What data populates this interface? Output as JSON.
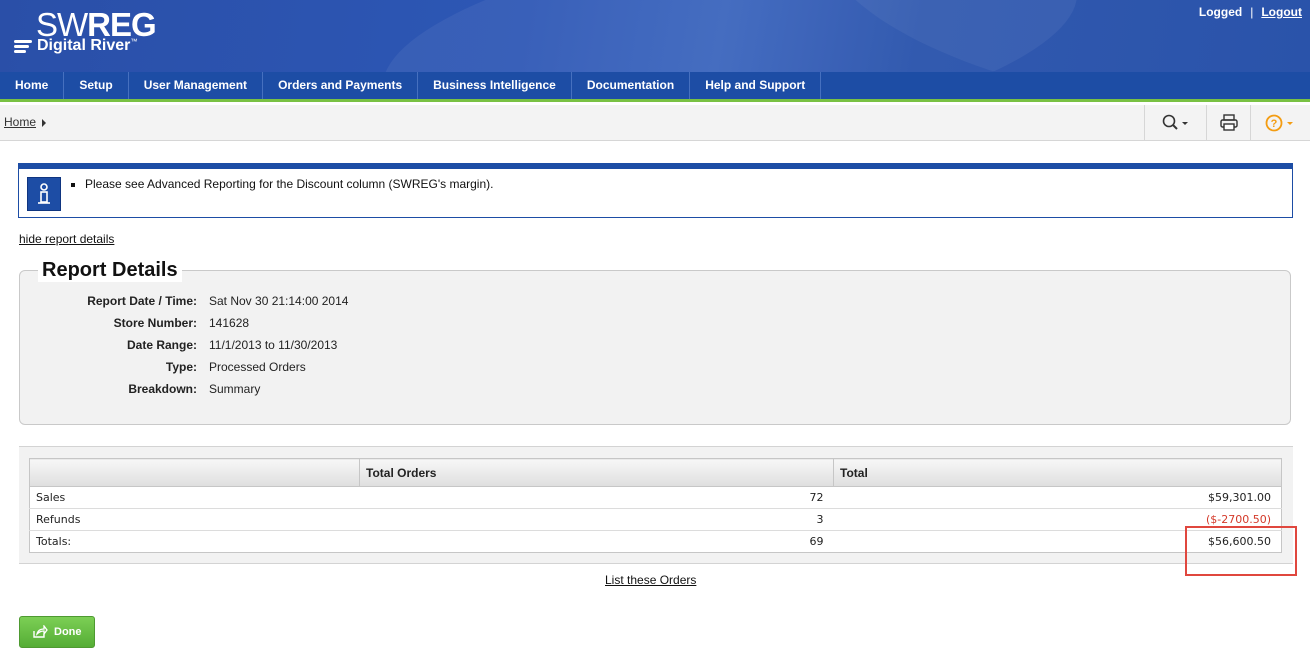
{
  "header": {
    "logo_top_light": "SW",
    "logo_top_bold": "REG",
    "logo_bottom": "Digital River",
    "logo_tm": "™",
    "logged": "Logged",
    "separator": "|",
    "logout": "Logout"
  },
  "nav": {
    "items": [
      "Home",
      "Setup",
      "User Management",
      "Orders and Payments",
      "Business Intelligence",
      "Documentation",
      "Help and Support"
    ],
    "background": "#1d4da5",
    "accent": "#79c143"
  },
  "breadcrumb": {
    "home": "Home"
  },
  "toolbar": {
    "icons": [
      "search-icon",
      "print-icon",
      "help-icon"
    ],
    "help_color": "#f39c12"
  },
  "info": {
    "message": "Please see Advanced Reporting for the Discount column (SWREG's margin)."
  },
  "hide_details": "hide report details",
  "details": {
    "title": "Report Details",
    "rows": [
      {
        "label": "Report Date / Time:",
        "value": "Sat Nov 30 21:14:00 2014"
      },
      {
        "label": "Store Number:",
        "value": "141628"
      },
      {
        "label": "Date Range:",
        "value": "11/1/2013 to 11/30/2013"
      },
      {
        "label": "Type:",
        "value": "Processed Orders"
      },
      {
        "label": "Breakdown:",
        "value": "Summary"
      }
    ]
  },
  "table": {
    "headers": [
      "",
      "Total Orders",
      "Total"
    ],
    "rows": [
      {
        "label": "Sales",
        "orders": "72",
        "total": "$59,301.00"
      },
      {
        "label": "Refunds",
        "orders": "3",
        "total": "($-2700.50)"
      },
      {
        "label": "Totals:",
        "orders": "69",
        "total": "$56,600.50"
      }
    ],
    "negative_color": "#d43a2a"
  },
  "list_orders": "List these Orders",
  "done_label": "Done",
  "highlight_color": "#e0473e"
}
